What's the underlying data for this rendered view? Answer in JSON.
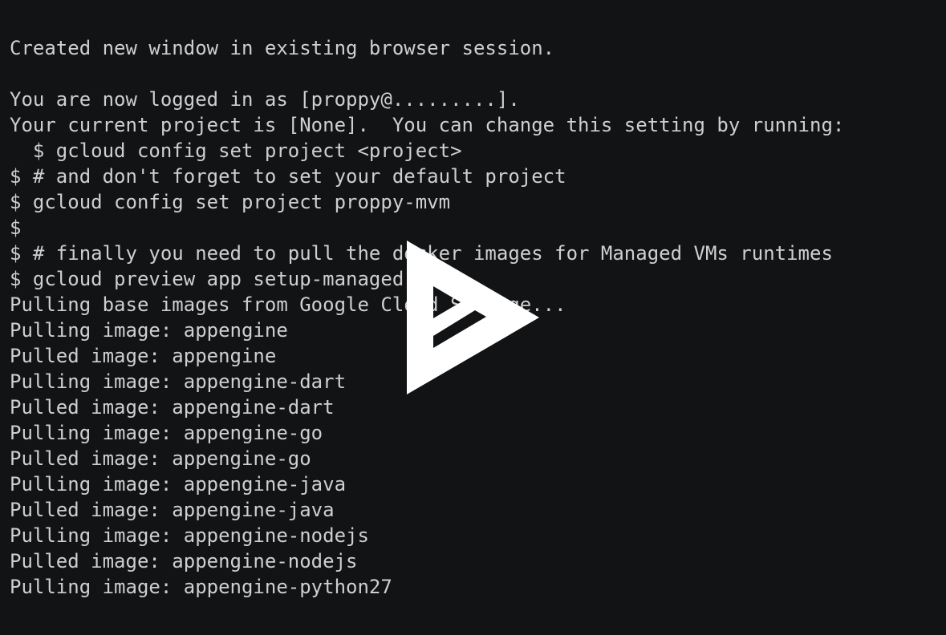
{
  "terminal": {
    "background": "#121314",
    "foreground": "#cfcfcf",
    "lines": [
      "Created new window in existing browser session.",
      "",
      "You are now logged in as [proppy@.........].",
      "Your current project is [None].  You can change this setting by running:",
      "  $ gcloud config set project <project>",
      "$ # and don't forget to set your default project",
      "$ gcloud config set project proppy-mvm",
      "$",
      "$ # finally you need to pull the docker images for Managed VMs runtimes",
      "$ gcloud preview app setup-managed-vms",
      "Pulling base images from Google Cloud Storage...",
      "Pulling image: appengine",
      "Pulled image: appengine",
      "Pulling image: appengine-dart",
      "Pulled image: appengine-dart",
      "Pulling image: appengine-go",
      "Pulled image: appengine-go",
      "Pulling image: appengine-java",
      "Pulled image: appengine-java",
      "Pulling image: appengine-nodejs",
      "Pulled image: appengine-nodejs",
      "Pulling image: appengine-python27"
    ]
  },
  "overlay": {
    "icon": "asciinema-play-icon",
    "icon_color": "#ffffff"
  }
}
